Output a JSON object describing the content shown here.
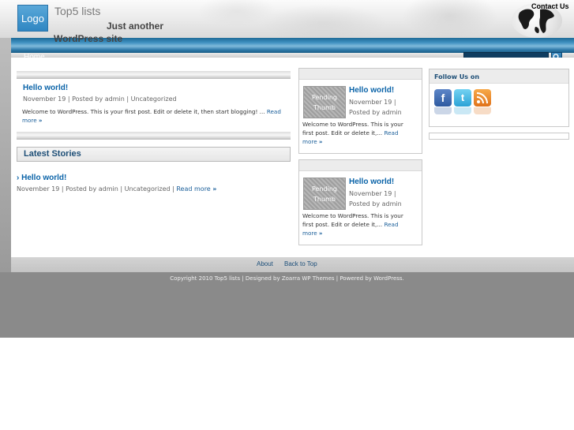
{
  "header": {
    "logo_text": "Logo",
    "site_title": "Top5 lists",
    "tagline_line1": "Just another",
    "tagline_line2": "WordPress site",
    "contact_link": "Contact Us"
  },
  "nav": {
    "home": "Home",
    "search_placeholder": ""
  },
  "featured_post": {
    "title": "Hello world!",
    "meta": "November 19 | Posted by admin | Uncategorized",
    "excerpt": "Welcome to WordPress. This is your first post. Edit or delete it, then start blogging! ...",
    "read_more_1": "Read",
    "read_more_2": "more"
  },
  "latest": {
    "heading": "Latest Stories",
    "title": "› Hello world!",
    "meta": "November 19 | Posted by admin | Uncategorized |",
    "read_more": "Read more"
  },
  "mid_posts": [
    {
      "thumb_line1": "Pending",
      "thumb_line2": "Thumb",
      "title": "Hello world!",
      "date": "November 19 |",
      "author": "Posted by admin",
      "excerpt_1": "Welcome to WordPress. This is your",
      "excerpt_2": "first post. Edit or delete it,...",
      "read_1": "Read",
      "read_2": "more"
    },
    {
      "thumb_line1": "Pending",
      "thumb_line2": "Thumb",
      "title": "Hello world!",
      "date": "November 19 |",
      "author": "Posted by admin",
      "excerpt_1": "Welcome to WordPress. This is your",
      "excerpt_2": "first post. Edit or delete it,...",
      "read_1": "Read",
      "read_2": "more"
    }
  ],
  "sidebar": {
    "follow_title": "Follow Us on",
    "facebook": "f",
    "twitter": "t",
    "rss": "rss-icon"
  },
  "footer": {
    "about": "About",
    "back_to_top": "Back to Top",
    "copyright": "Copyright 2010 Top5 lists | Designed by Zoarra WP Themes | Powered by WordPress."
  },
  "colors": {
    "link": "#0a63a8",
    "nav_band": "#2f7aaa",
    "footer_dark": "#8a8a8a"
  }
}
